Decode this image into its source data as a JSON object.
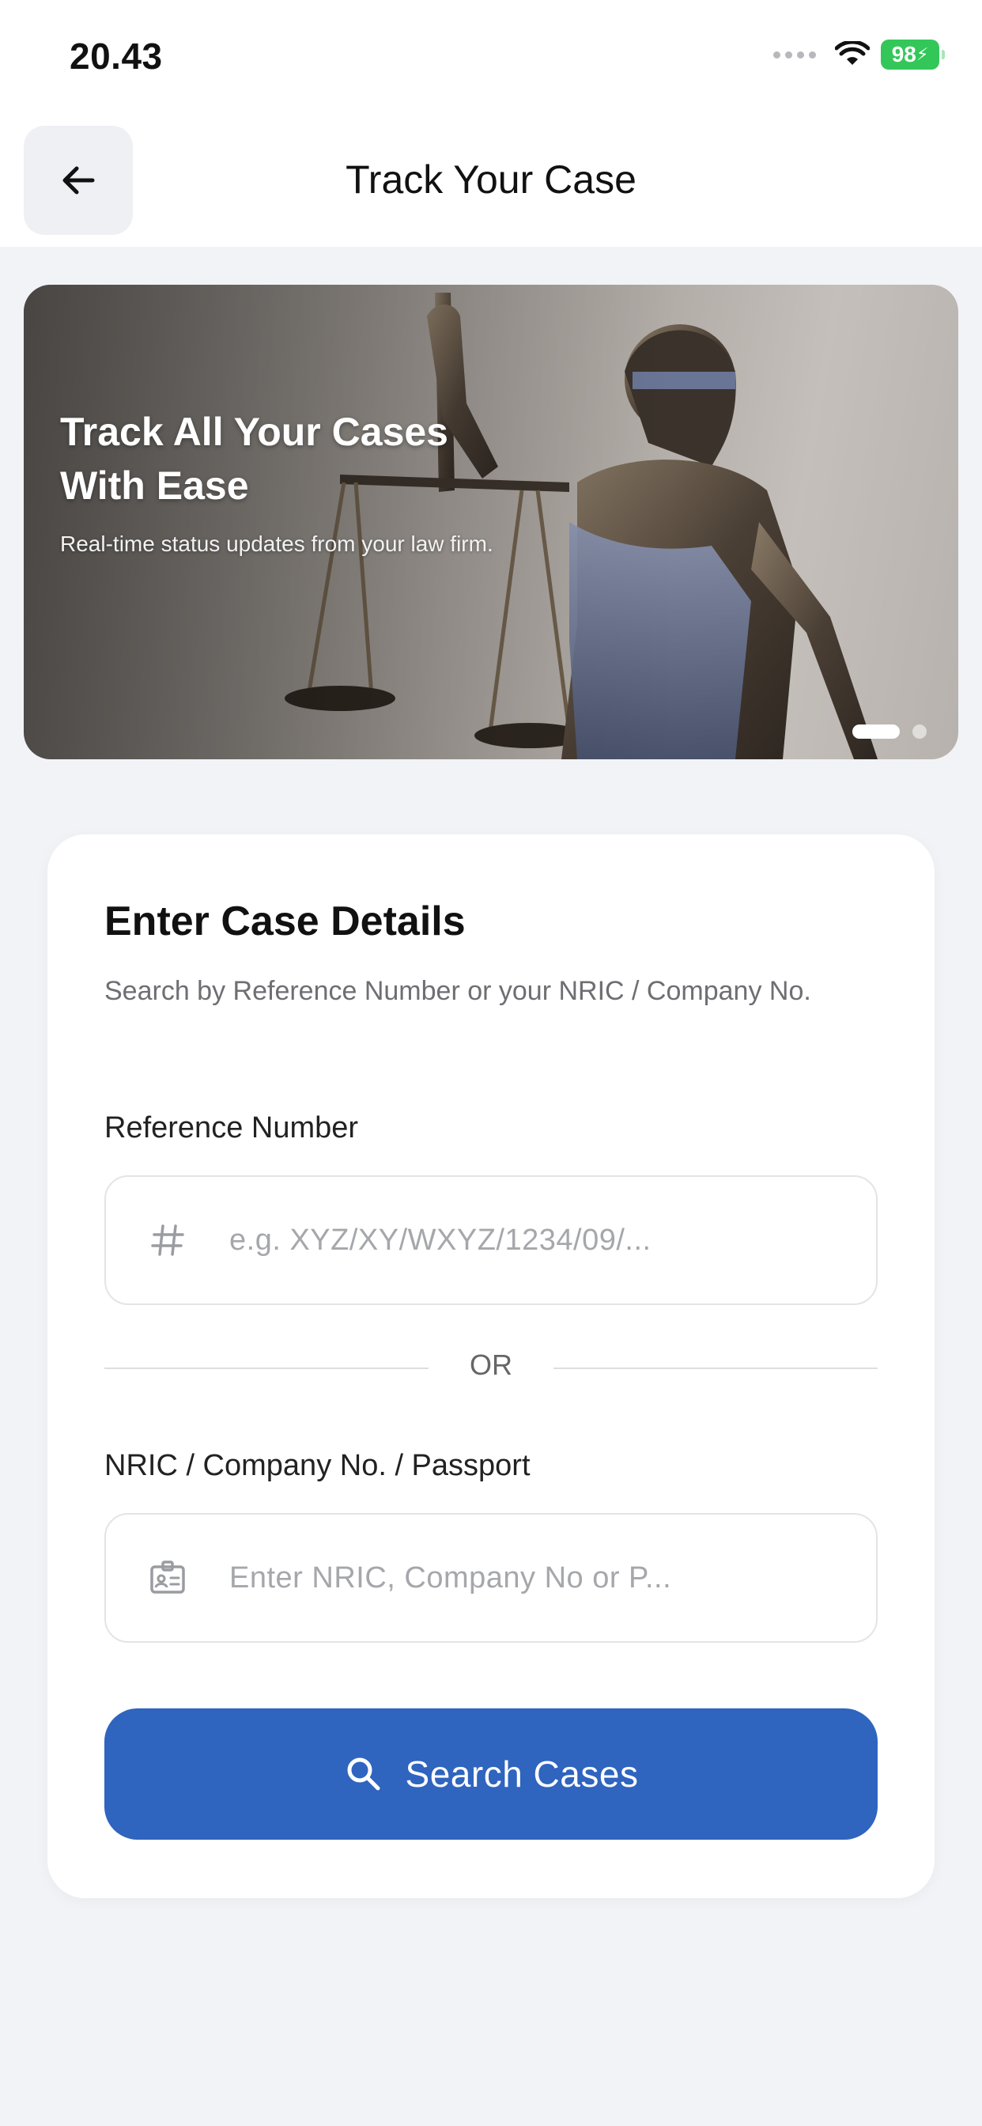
{
  "status_bar": {
    "time": "20.43",
    "battery": "98"
  },
  "header": {
    "title": "Track Your Case",
    "back_icon": "arrow-left-icon"
  },
  "banner": {
    "title": "Track All Your Cases With Ease",
    "subtitle": "Real-time status updates from your law firm.",
    "carousel": {
      "total_slides": 2,
      "active_slide": 1
    }
  },
  "form": {
    "title": "Enter Case Details",
    "description": "Search by Reference Number or your NRIC / Company No.",
    "reference": {
      "label": "Reference Number",
      "placeholder": "e.g. XYZ/XY/WXYZ/1234/09/...",
      "icon": "hash-icon"
    },
    "divider": "OR",
    "nric": {
      "label": "NRIC / Company No. / Passport",
      "placeholder": "Enter NRIC, Company No or P...",
      "icon": "id-card-icon"
    },
    "search_button": {
      "label": "Search Cases",
      "icon": "search-icon"
    }
  },
  "colors": {
    "primary": "#2f64bf",
    "background": "#f1f3f7",
    "battery": "#33c759"
  }
}
